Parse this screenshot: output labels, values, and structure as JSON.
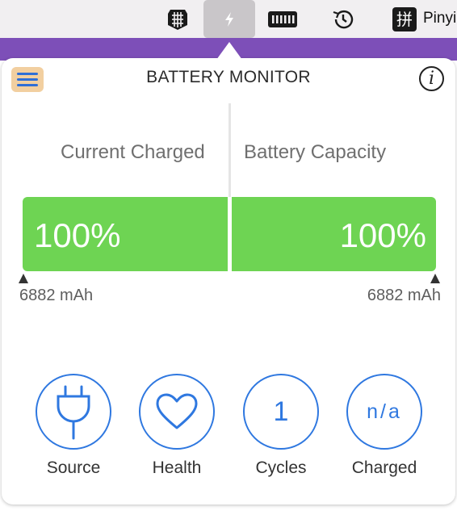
{
  "menubar": {
    "items": [
      {
        "icon": "shield-grid-icon"
      },
      {
        "icon": "battery-monitor-bolt-icon",
        "active": true
      },
      {
        "icon": "memory-chip-icon"
      },
      {
        "icon": "history-clock-icon"
      },
      {
        "icon": "pinyin-input-icon",
        "glyph": "拼",
        "label": "Pinyin"
      }
    ]
  },
  "popover": {
    "title": "BATTERY MONITOR",
    "current": {
      "label": "Current Charged",
      "percent": "100%",
      "mah": "6882 mAh"
    },
    "capacity": {
      "label": "Battery Capacity",
      "percent": "100%",
      "mah": "6882 mAh"
    },
    "buttons": [
      {
        "label": "Source",
        "icon": "plug-icon"
      },
      {
        "label": "Health",
        "icon": "heart-icon"
      },
      {
        "label": "Cycles",
        "value": "1"
      },
      {
        "label": "Charged",
        "value": "n/a"
      }
    ]
  },
  "colors": {
    "accent_blue": "#2f78e0",
    "bar_green": "#6ed453",
    "desktop_purple": "#7d4fb8",
    "menu_button_bg": "#f2cfa0"
  }
}
